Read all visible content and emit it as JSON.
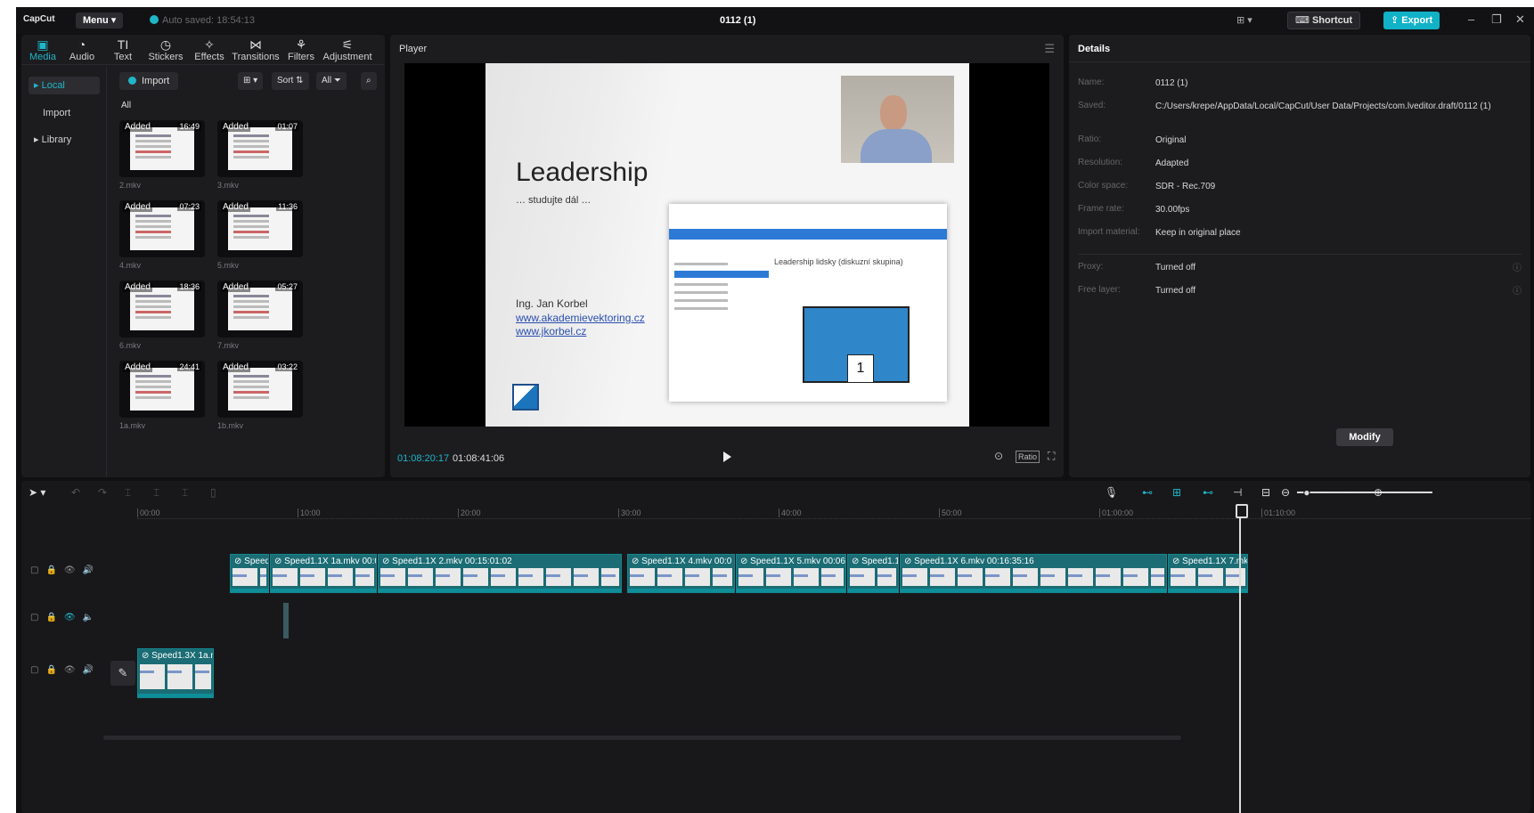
{
  "titlebar": {
    "logo": "CapCut",
    "menu_label": "Menu",
    "autosave": "Auto saved: 18:54:13",
    "project_title": "0112 (1)",
    "shortcut_label": "Shortcut",
    "export_label": "Export"
  },
  "media_tabs": [
    {
      "label": "Media",
      "icon": "media-icon"
    },
    {
      "label": "Audio",
      "icon": "audio-icon"
    },
    {
      "label": "Text",
      "icon": "text-icon"
    },
    {
      "label": "Stickers",
      "icon": "stickers-icon"
    },
    {
      "label": "Effects",
      "icon": "effects-icon"
    },
    {
      "label": "Transitions",
      "icon": "transitions-icon"
    },
    {
      "label": "Filters",
      "icon": "filters-icon"
    },
    {
      "label": "Adjustment",
      "icon": "adjustment-icon"
    }
  ],
  "sidebar": {
    "local": "Local",
    "import": "Import",
    "library": "Library"
  },
  "media_toolbar": {
    "import_label": "Import",
    "sort_label": "Sort",
    "all_label": "All",
    "section_all": "All"
  },
  "media_items": [
    {
      "badge": "Added",
      "duration": "16:49",
      "name": "2.mkv"
    },
    {
      "badge": "Added",
      "duration": "01:07",
      "name": "3.mkv"
    },
    {
      "badge": "Added",
      "duration": "07:23",
      "name": "4.mkv"
    },
    {
      "badge": "Added",
      "duration": "11:36",
      "name": "5.mkv"
    },
    {
      "badge": "Added",
      "duration": "18:36",
      "name": "6.mkv"
    },
    {
      "badge": "Added",
      "duration": "05:27",
      "name": "7.mkv"
    },
    {
      "badge": "Added",
      "duration": "24:41",
      "name": "1a.mkv"
    },
    {
      "badge": "Added",
      "duration": "03:22",
      "name": "1b.mkv"
    }
  ],
  "player": {
    "title": "Player",
    "current_time": "01:08:20:17",
    "total_time": "01:08:41:06",
    "ratio_label": "Ratio",
    "slide": {
      "title": "Leadership",
      "subtitle": "… studujte dál …",
      "author": "Ing. Jan Korbel",
      "link1": "www.akademievektoring.cz",
      "link2": "www.jkorbel.cz",
      "embedded_heading": "Leadership lidsky (diskuzní skupina)"
    }
  },
  "details": {
    "title": "Details",
    "rows": [
      {
        "key": "Name:",
        "value": "0112 (1)"
      },
      {
        "key": "Saved:",
        "value": "C:/Users/krepe/AppData/Local/CapCut/User Data/Projects/com.lveditor.draft/0112 (1)"
      },
      {
        "key": "Ratio:",
        "value": "Original"
      },
      {
        "key": "Resolution:",
        "value": "Adapted"
      },
      {
        "key": "Color space:",
        "value": "SDR - Rec.709"
      },
      {
        "key": "Frame rate:",
        "value": "30.00fps"
      },
      {
        "key": "Import material:",
        "value": "Keep in original place"
      }
    ],
    "extra_rows": [
      {
        "key": "Proxy:",
        "value": "Turned off"
      },
      {
        "key": "Free layer:",
        "value": "Turned off"
      }
    ],
    "modify_label": "Modify"
  },
  "timeline": {
    "ruler": [
      "00:00",
      "10:00",
      "20:00",
      "30:00",
      "40:00",
      "50:00",
      "01:00:00",
      "01:10:00"
    ],
    "main_clips": [
      {
        "label": "Speed"
      },
      {
        "label": "Speed1.1X  1a.mkv  00:0"
      },
      {
        "label": "Speed1.1X  2.mkv  00:15:01:02"
      },
      {
        "label": "Speed1.1X  4.mkv  00:0"
      },
      {
        "label": "Speed1.1X  5.mkv  00:06"
      },
      {
        "label": "Speed1.1:"
      },
      {
        "label": "Speed1.1X  6.mkv  00:16:35:16"
      },
      {
        "label": "Speed1.1X  7.mk"
      }
    ],
    "bottom_clip": {
      "label": "Speed1.3X  1a.m"
    }
  },
  "colors": {
    "accent": "#1fb6c8",
    "clip": "#1b6c74",
    "panel": "#1c1c1f"
  }
}
